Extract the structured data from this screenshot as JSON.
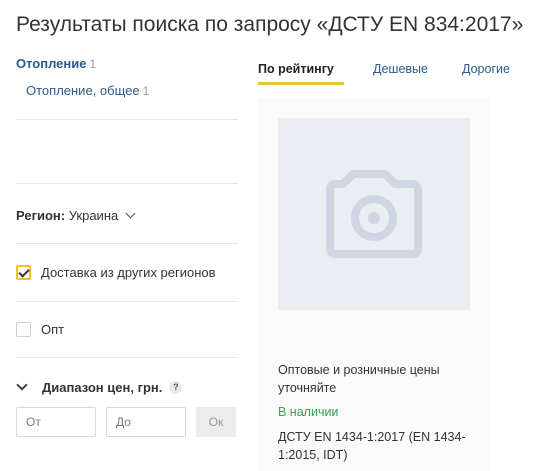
{
  "page": {
    "title": "Результаты поиска по запросу «ДСТУ EN 834:2017»"
  },
  "sidebar": {
    "categories": [
      {
        "label": "Отопление",
        "count": "1"
      },
      {
        "label": "Отопление, общее",
        "count": "1"
      }
    ],
    "region_label": "Регион:",
    "region_value": "Украина",
    "delivery_label": "Доставка из других регионов",
    "delivery_checked": true,
    "wholesale_label": "Опт",
    "wholesale_checked": false,
    "price_range_label": "Диапазон цен, грн.",
    "help_glyph": "?",
    "price_from_placeholder": "От",
    "price_to_placeholder": "До",
    "ok_label": "Ок"
  },
  "sort_tabs": [
    {
      "label": "По рейтингу",
      "active": true
    },
    {
      "label": "Дешевые",
      "active": false
    },
    {
      "label": "Дорогие",
      "active": false
    }
  ],
  "product": {
    "image_icon": "camera-icon",
    "price_note": "Оптовые и розничные цены уточняйте",
    "availability": "В наличии",
    "name": "ДСТУ EN 1434-1:2017 (EN 1434-1:2015, IDT)"
  },
  "colors": {
    "accent": "#f0c02c",
    "link": "#2a5b8b",
    "in_stock": "#3aa04a",
    "placeholder_bg": "#eaedf2",
    "camera_glyph": "#cfd6e2"
  }
}
